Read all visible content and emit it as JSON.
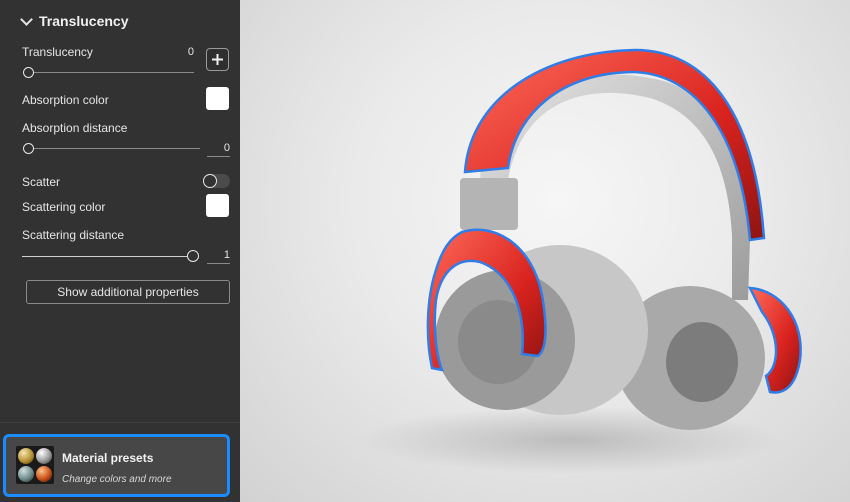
{
  "panel": {
    "section_title": "Translucency",
    "translucency": {
      "label": "Translucency",
      "value": "0",
      "add_label": "+"
    },
    "absorption_color": {
      "label": "Absorption color",
      "color": "#ffffff"
    },
    "absorption_distance": {
      "label": "Absorption distance",
      "value": "0"
    },
    "scatter": {
      "label": "Scatter",
      "enabled": false
    },
    "scattering_color": {
      "label": "Scattering color",
      "color": "#ffffff"
    },
    "scattering_distance": {
      "label": "Scattering distance",
      "value": "1"
    },
    "show_additional_label": "Show additional properties"
  },
  "presets": {
    "title": "Material presets",
    "subtitle": "Change colors and more"
  },
  "viewport": {
    "object": "headphones",
    "selection_color": "#2f7de8",
    "band_color": "#e0302f"
  }
}
